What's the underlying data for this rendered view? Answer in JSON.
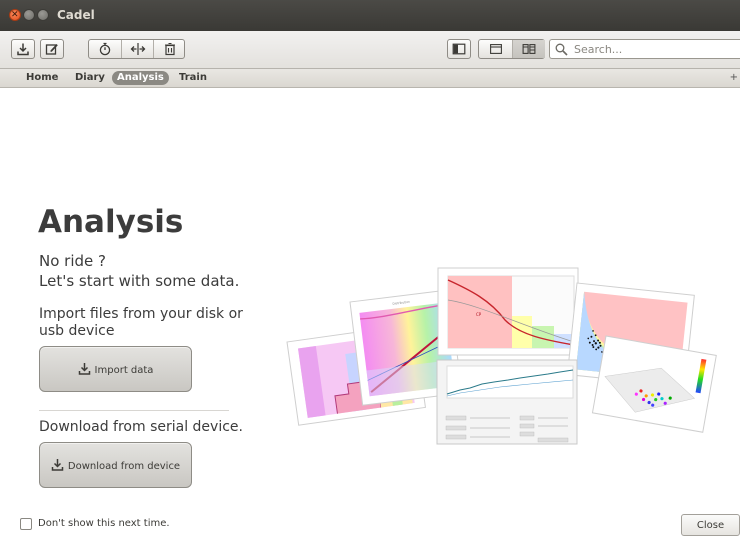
{
  "window": {
    "title": "Cadel"
  },
  "toolbar": {
    "buttons": [
      {
        "icon": "download-icon"
      },
      {
        "icon": "edit-icon"
      },
      {
        "icon": "stopwatch-icon"
      },
      {
        "icon": "split-icon"
      },
      {
        "icon": "trash-icon"
      }
    ],
    "view_toggles": [
      "sidebar-toggle-icon",
      "single-view-icon",
      "tile-view-icon"
    ],
    "search": {
      "value": "",
      "placeholder": "Search..."
    }
  },
  "tabs": [
    {
      "label": "Home",
      "active": false
    },
    {
      "label": "Diary",
      "active": false
    },
    {
      "label": "Analysis",
      "active": true
    },
    {
      "label": "Train",
      "active": false
    }
  ],
  "tab_add": "+",
  "main": {
    "heading": "Analysis",
    "no_ride_1": "No ride ?",
    "no_ride_2": "Let's start with some data.",
    "import_text_1": "Import files from your disk or",
    "import_text_2": "usb device",
    "import_button": "Import data",
    "serial_text": "Download from serial device.",
    "download_button": "Download from device"
  },
  "footer": {
    "dont_show": "Don't show this next time.",
    "dont_show_checked": false,
    "close_button": "Close"
  },
  "colors": {
    "titlebar": "#3c3b37",
    "close_button": "#e2511e",
    "active_tab": "#8b8983",
    "text": "#3c3c3c"
  }
}
